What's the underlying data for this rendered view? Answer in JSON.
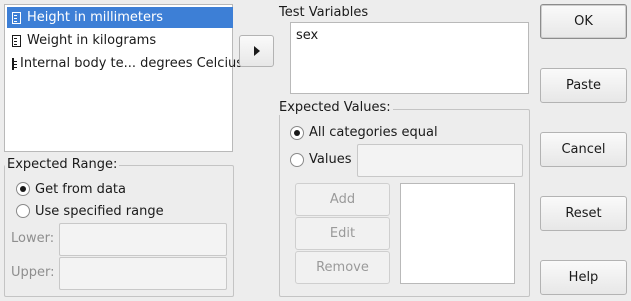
{
  "source_list": {
    "items": [
      {
        "label": "Height in millimeters",
        "selected": true
      },
      {
        "label": "Weight in kilograms",
        "selected": false
      },
      {
        "label": "Internal body te... degrees Celcius",
        "selected": false
      }
    ]
  },
  "move_button": {
    "icon": "triangle-right-icon"
  },
  "test_variables": {
    "title": "Test Variables",
    "items": [
      "sex"
    ]
  },
  "expected_range": {
    "title": "Expected Range:",
    "options": [
      "Get from data",
      "Use specified range"
    ],
    "selected": "Get from data",
    "lower_label": "Lower:",
    "upper_label": "Upper:",
    "lower_value": "",
    "upper_value": ""
  },
  "expected_values": {
    "title": "Expected Values:",
    "all_equal_label": "All categories equal",
    "values_label": "Values",
    "selected": "All categories equal",
    "values_input": "",
    "add_label": "Add",
    "edit_label": "Edit",
    "remove_label": "Remove"
  },
  "dialog_buttons": {
    "ok": "OK",
    "paste": "Paste",
    "cancel": "Cancel",
    "reset": "Reset",
    "help": "Help"
  }
}
